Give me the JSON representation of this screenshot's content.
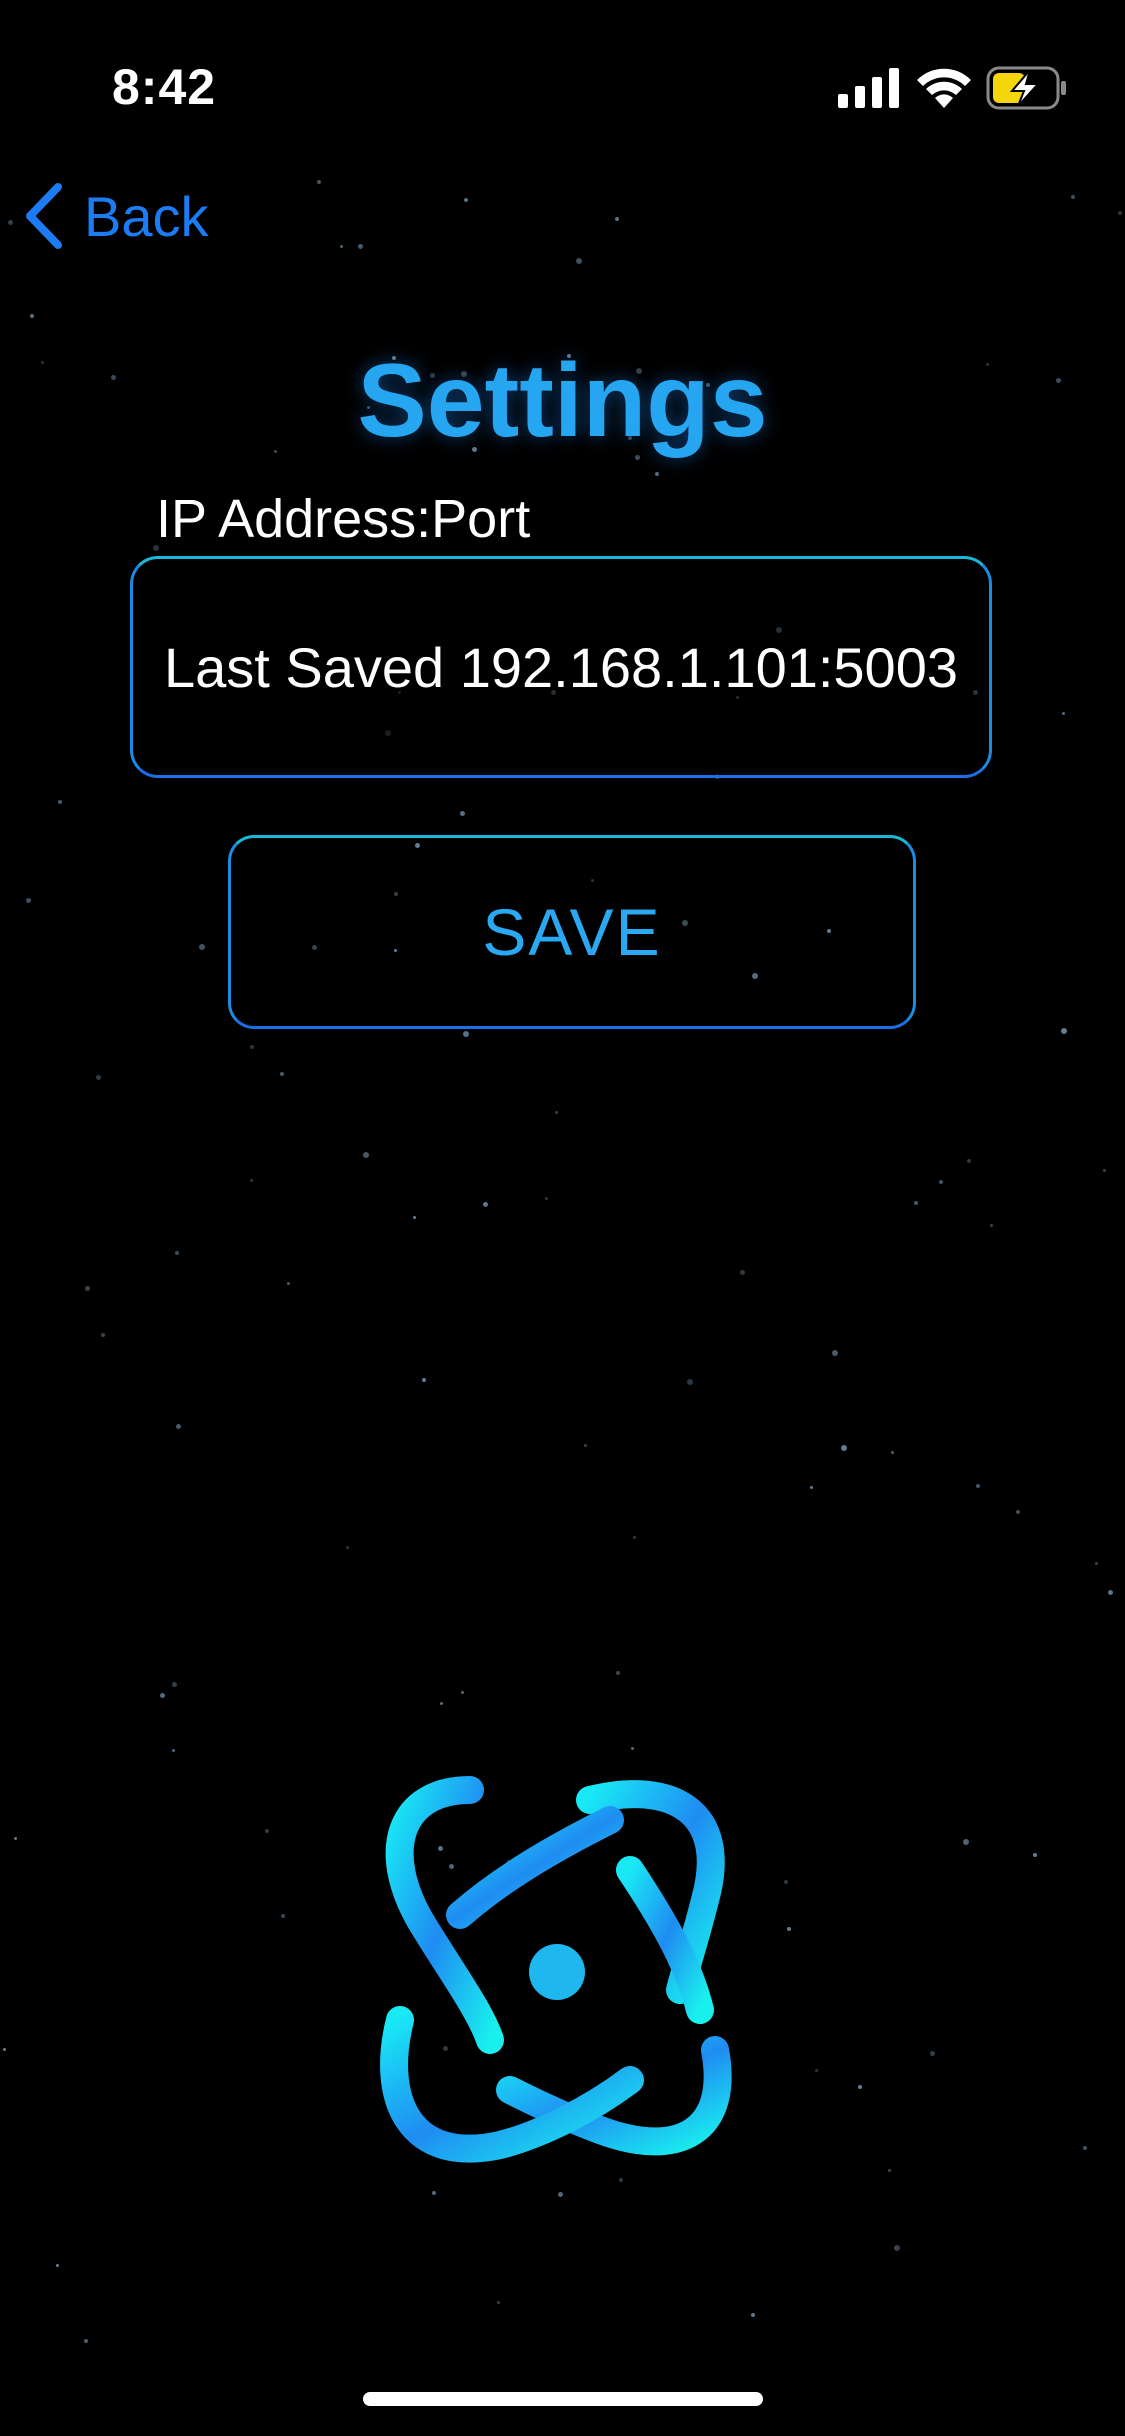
{
  "status_bar": {
    "time": "8:42",
    "icons": [
      "signal-icon",
      "wifi-icon",
      "battery-charging-icon"
    ]
  },
  "nav": {
    "back_label": "Back",
    "back_icon": "chevron-left-icon"
  },
  "page": {
    "title": "Settings"
  },
  "form": {
    "ip_label": "IP Address:Port",
    "ip_placeholder": "Last Saved 192.168.1.101:5003",
    "ip_value": "",
    "save_label": "SAVE"
  },
  "logo": {
    "icon": "atom-logo-icon"
  },
  "colors": {
    "background": "#000000",
    "accent_blue": "#1c7cf5",
    "title_blue": "#26a6f0",
    "border_cyan": "#19b8d9",
    "logo_cyan": "#1ff0f0",
    "battery_yellow": "#f5d60a"
  }
}
